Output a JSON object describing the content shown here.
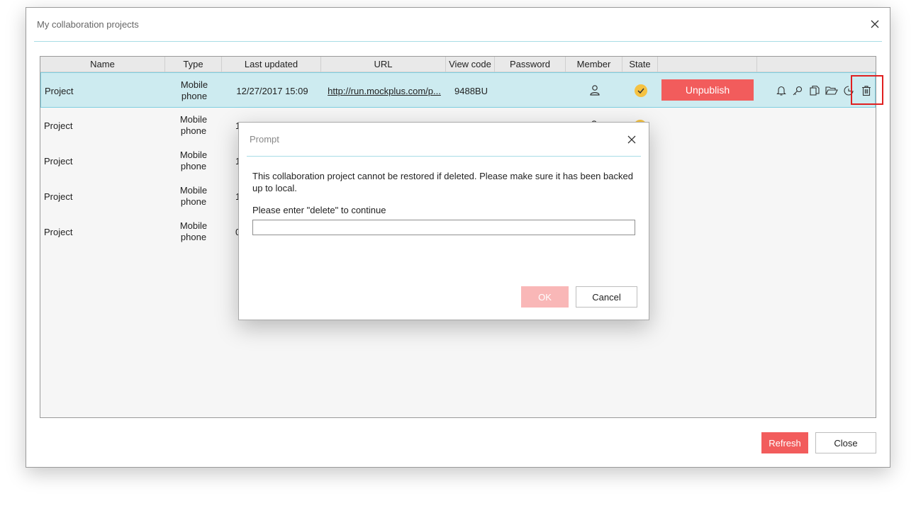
{
  "window": {
    "title": "My collaboration projects"
  },
  "table": {
    "columns": [
      "Name",
      "Type",
      "Last updated",
      "URL",
      "View code",
      "Password",
      "Member",
      "State",
      ""
    ],
    "rows": [
      {
        "name": "Project",
        "type_line1": "Mobile",
        "type_line2": "phone",
        "last_updated": "12/27/2017 15:09",
        "url": "http://run.mockplus.com/p...",
        "view_code": "9488BU",
        "password": "",
        "unpublish_label": "Unpublish"
      },
      {
        "name": "Project",
        "type_line1": "Mobile",
        "type_line2": "phone",
        "last_updated": "1"
      },
      {
        "name": "Project",
        "type_line1": "Mobile",
        "type_line2": "phone",
        "last_updated": "1"
      },
      {
        "name": "Project",
        "type_line1": "Mobile",
        "type_line2": "phone",
        "last_updated": "1"
      },
      {
        "name": "Project",
        "type_line1": "Mobile",
        "type_line2": "phone",
        "last_updated": "0"
      }
    ]
  },
  "footer": {
    "refresh_label": "Refresh",
    "close_label": "Close"
  },
  "dialog": {
    "title": "Prompt",
    "message": "This collaboration project cannot be restored if deleted. Please make sure it has been backed up to local.",
    "prompt_label": "Please enter \"delete\" to continue",
    "input_value": "",
    "ok_label": "OK",
    "cancel_label": "Cancel"
  },
  "colors": {
    "accent_red": "#f25c5c",
    "selected_row": "#cdebf0",
    "state_yellow": "#f5c242",
    "divider_teal": "#a8dde6",
    "highlight_red": "#e02020"
  },
  "icons": [
    "close-icon",
    "member-icon",
    "state-check-icon",
    "bell-icon",
    "key-icon",
    "copy-icon",
    "folder-open-icon",
    "history-icon",
    "trash-icon"
  ]
}
